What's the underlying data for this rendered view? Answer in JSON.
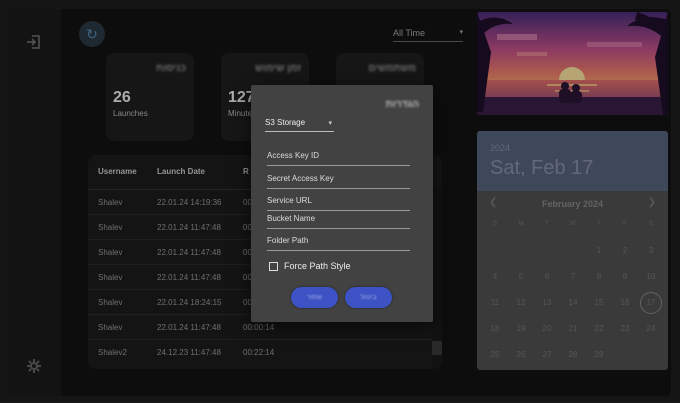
{
  "toolbar": {
    "time_filter": "All Time"
  },
  "cards": [
    {
      "title": "כניסות",
      "value": "26",
      "label": "Launches"
    },
    {
      "title": "זמן שימוש",
      "value": "127",
      "label": "Minutes"
    },
    {
      "title": "משתמשים",
      "value": "",
      "label": ""
    }
  ],
  "table": {
    "headers": [
      "Username",
      "Launch Date",
      "R"
    ],
    "rows": [
      {
        "user": "Shalev",
        "date": "22.01.24 14:19:36",
        "dur": "00"
      },
      {
        "user": "Shalev",
        "date": "22.01.24 11:47:48",
        "dur": "00"
      },
      {
        "user": "Shalev",
        "date": "22.01.24 11:47:48",
        "dur": "00"
      },
      {
        "user": "Shalev",
        "date": "22.01.24 11:47:48",
        "dur": "00"
      },
      {
        "user": "Shalev",
        "date": "22.01.24 18:24:15",
        "dur": "00"
      },
      {
        "user": "Shalev",
        "date": "22.01.24 11:47:48",
        "dur": "00:00:14"
      },
      {
        "user": "Shalev2",
        "date": "24.12.23 11:47:48",
        "dur": "00:22:14"
      }
    ]
  },
  "calendar": {
    "year": "2024",
    "date": "Sat, Feb 17",
    "month": "February 2024",
    "weekdays": [
      "S",
      "M",
      "T",
      "W",
      "T",
      "F",
      "S"
    ],
    "weeks": [
      [
        "",
        "",
        "",
        "",
        "1",
        "2",
        "3"
      ],
      [
        "4",
        "5",
        "6",
        "7",
        "8",
        "9",
        "10"
      ],
      [
        "11",
        "12",
        "13",
        "14",
        "15",
        "16",
        "17"
      ],
      [
        "18",
        "19",
        "20",
        "21",
        "22",
        "23",
        "24"
      ],
      [
        "25",
        "26",
        "27",
        "28",
        "29",
        "",
        ""
      ]
    ],
    "selected": "17"
  },
  "dialog": {
    "title": "הגדרות",
    "storage": "S3 Storage",
    "fields": [
      "Access Key ID",
      "Secret Access Key",
      "Service URL",
      "Bucket Name",
      "Folder Path"
    ],
    "checkbox": "Force Path Style",
    "save": "שמור",
    "cancel": "ביטול"
  },
  "colors": {
    "accent": "#3d52c4",
    "calendar_header": "#58637e"
  }
}
